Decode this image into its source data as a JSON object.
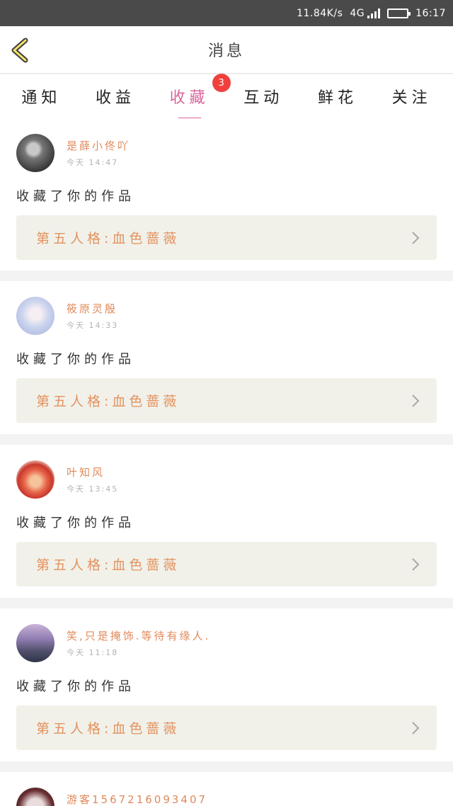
{
  "status_bar": {
    "speed": "11.84K/s",
    "network": "4G",
    "time": "16:17"
  },
  "header": {
    "title": "消息"
  },
  "tabs": [
    {
      "label": "通知"
    },
    {
      "label": "收益"
    },
    {
      "label": "收藏",
      "active": true,
      "badge": "3"
    },
    {
      "label": "互动"
    },
    {
      "label": "鲜花"
    },
    {
      "label": "关注"
    }
  ],
  "feed": [
    {
      "username": "是薛小佟吖",
      "time": "今天 14:47",
      "action": "收藏了你的作品",
      "work": "第五人格:血色蔷薇"
    },
    {
      "username": "筱原灵殷",
      "time": "今天 14:33",
      "action": "收藏了你的作品",
      "work": "第五人格:血色蔷薇"
    },
    {
      "username": "叶知风",
      "time": "今天 13:45",
      "action": "收藏了你的作品",
      "work": "第五人格:血色蔷薇"
    },
    {
      "username": "笑,只是掩饰.等待有缘人.",
      "time": "今天 11:18",
      "action": "收藏了你的作品",
      "work": "第五人格:血色蔷薇"
    },
    {
      "username": "游客1567216093407"
    }
  ],
  "colors": {
    "accent": "#d9669c",
    "badge": "#f0403e",
    "username": "#e08a5c",
    "work_title": "#e3935f",
    "work_bg": "#f1f1ea"
  },
  "icons": {
    "back": "back-arrow-icon",
    "chevron": "chevron-right-icon",
    "battery": "battery-icon",
    "signal": "signal-icon"
  }
}
